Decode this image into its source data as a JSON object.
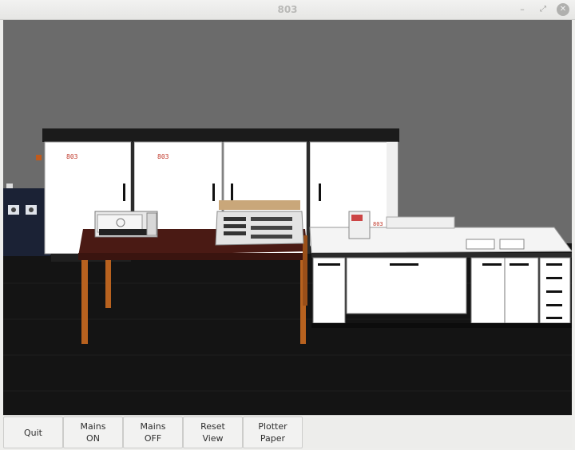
{
  "window": {
    "title": "803",
    "controls": {
      "minimize_glyph": "–",
      "maximize_glyph": "⤢",
      "close_glyph": "✕"
    }
  },
  "scene": {
    "cabinet_label": "803",
    "console_label": "803",
    "colors": {
      "wall": "#6b6b6b",
      "floor": "#141414",
      "cabinet": "#ffffff",
      "cabinet_top": "#1b1b1b",
      "table_top": "#4a1a14",
      "table_legs": "#b8621f",
      "label_red": "#c0392b",
      "power_box": "#1b2235"
    }
  },
  "toolbar": {
    "buttons": [
      {
        "line1": "Quit",
        "line2": ""
      },
      {
        "line1": "Mains",
        "line2": "ON"
      },
      {
        "line1": "Mains",
        "line2": "OFF"
      },
      {
        "line1": "Reset",
        "line2": "View"
      },
      {
        "line1": "Plotter",
        "line2": "Paper"
      }
    ]
  }
}
